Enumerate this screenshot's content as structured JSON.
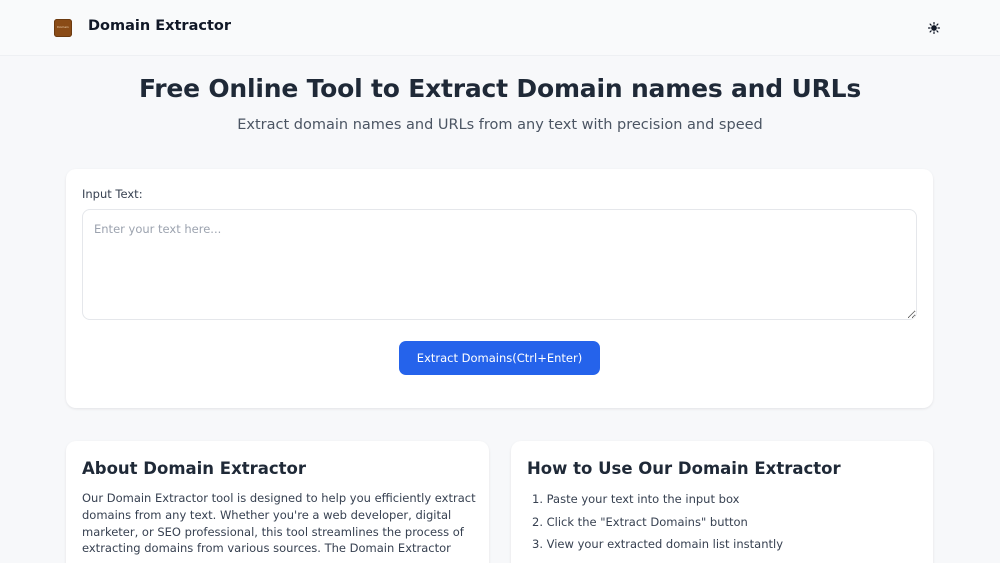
{
  "header": {
    "logo_text": "Domain",
    "brand": "Domain Extractor",
    "theme_icon": "sun-icon"
  },
  "hero": {
    "title": "Free Online Tool to Extract Domain names and URLs",
    "subtitle": "Extract domain names and URLs from any text with precision and speed"
  },
  "input": {
    "label": "Input Text:",
    "placeholder": "Enter your text here...",
    "value": "",
    "button_label": "Extract Domains(Ctrl+Enter)"
  },
  "about": {
    "title": "About Domain Extractor",
    "text": "Our Domain Extractor tool is designed to help you efficiently extract domains from any text. Whether you're a web developer, digital marketer, or SEO professional, this tool streamlines the process of extracting domains from various sources. The Domain Extractor"
  },
  "howto": {
    "title": "How to Use Our Domain Extractor",
    "steps": [
      "1. Paste your text into the input box",
      "2. Click the \"Extract Domains\" button",
      "3. View your extracted domain list instantly"
    ]
  },
  "colors": {
    "accent": "#2563eb",
    "background": "#f7f8fa",
    "card": "#ffffff",
    "logo": "#8a4b16"
  }
}
